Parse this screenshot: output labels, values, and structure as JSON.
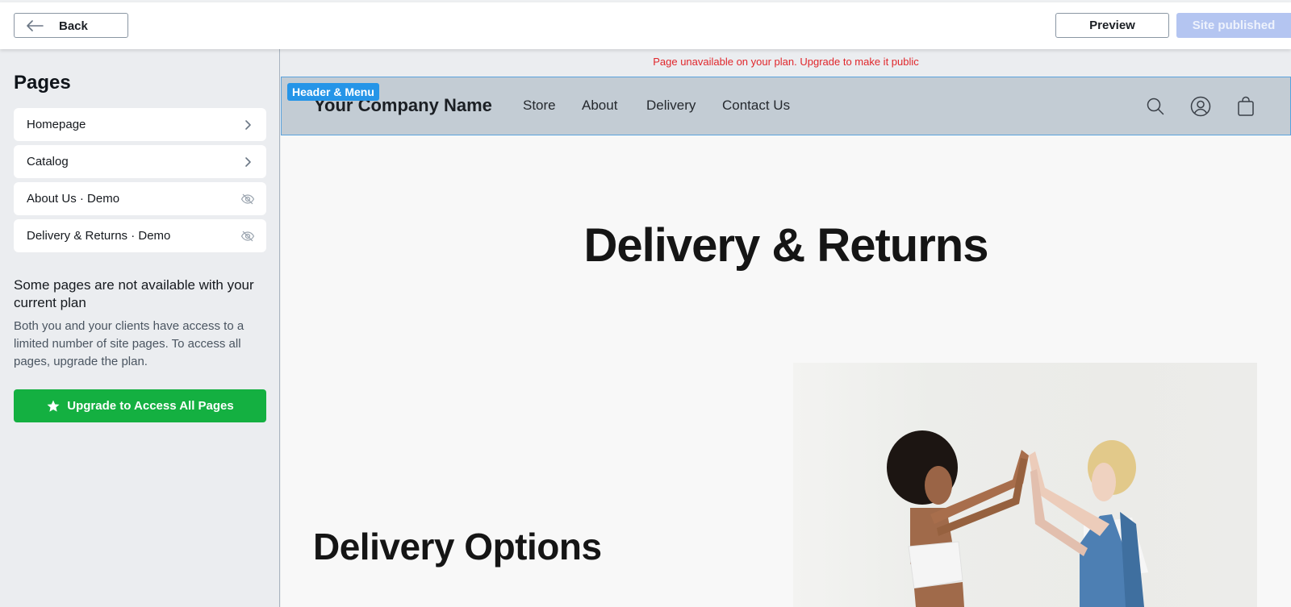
{
  "topbar": {
    "back_label": "Back",
    "preview_label": "Preview",
    "published_label": "Site published"
  },
  "sidebar": {
    "title": "Pages",
    "items": [
      {
        "label": "Homepage",
        "icon": "chevron-right-icon"
      },
      {
        "label": "Catalog",
        "icon": "chevron-right-icon"
      },
      {
        "label": "About Us · Demo",
        "icon": "eye-off-icon"
      },
      {
        "label": "Delivery & Returns · Demo",
        "icon": "eye-off-icon"
      }
    ],
    "notice_title": "Some pages are not available with your current plan",
    "notice_body": "Both you and your clients have access to a limited number of site pages. To access all pages, upgrade the plan.",
    "upgrade_label": "Upgrade to Access All Pages"
  },
  "canvas": {
    "warning": "Page unavailable on your plan. Upgrade to make it public",
    "header_badge": "Header & Menu",
    "company_name": "Your Company Name",
    "nav": [
      "Store",
      "About",
      "Delivery",
      "Contact Us"
    ],
    "header_icons": [
      "search-icon",
      "account-icon",
      "shopping-bag-icon"
    ],
    "hero_title": "Delivery & Returns",
    "section_title": "Delivery Options",
    "image_description": "Two people giving a high five against a white wall"
  },
  "colors": {
    "primary_green": "#14b041",
    "published_disabled": "#b4c5f1",
    "warning_red": "#e0262b",
    "badge_blue": "#2595e8",
    "header_bg": "#c3ccd4"
  }
}
